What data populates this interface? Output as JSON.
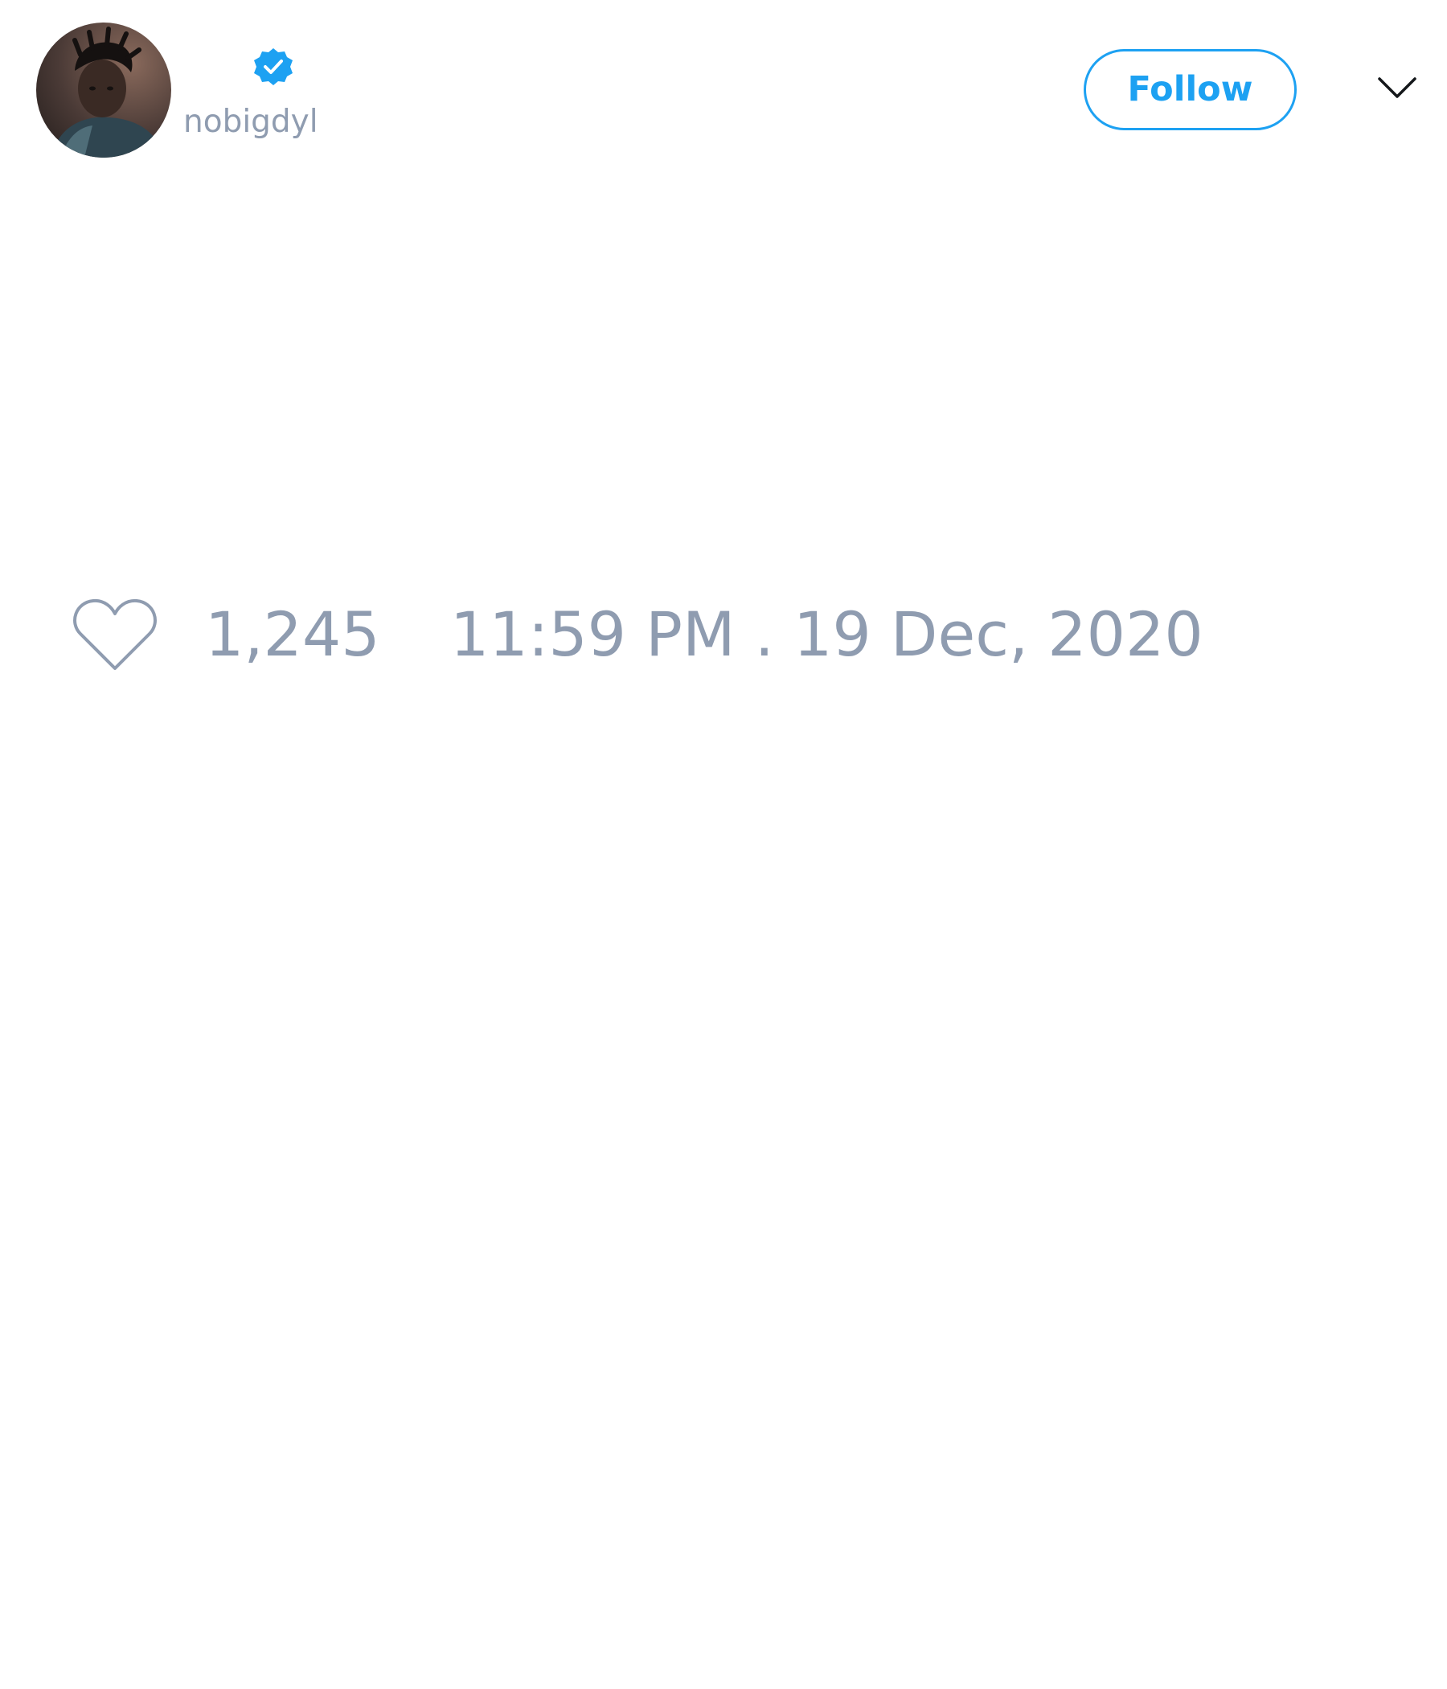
{
  "colors": {
    "accent": "#1da1f2",
    "muted_text": "#8f9cb0",
    "caret": "#14171a",
    "background": "#ffffff"
  },
  "header": {
    "avatar_icon": "user-avatar-photo",
    "verified_icon": "verified-badge-icon",
    "handle": "nobigdyl",
    "follow_label": "Follow",
    "menu_icon": "chevron-down-icon"
  },
  "stats": {
    "like_icon": "heart-outline-icon",
    "like_count": "1,245",
    "timestamp": "11:59 PM . 19 Dec, 2020"
  }
}
